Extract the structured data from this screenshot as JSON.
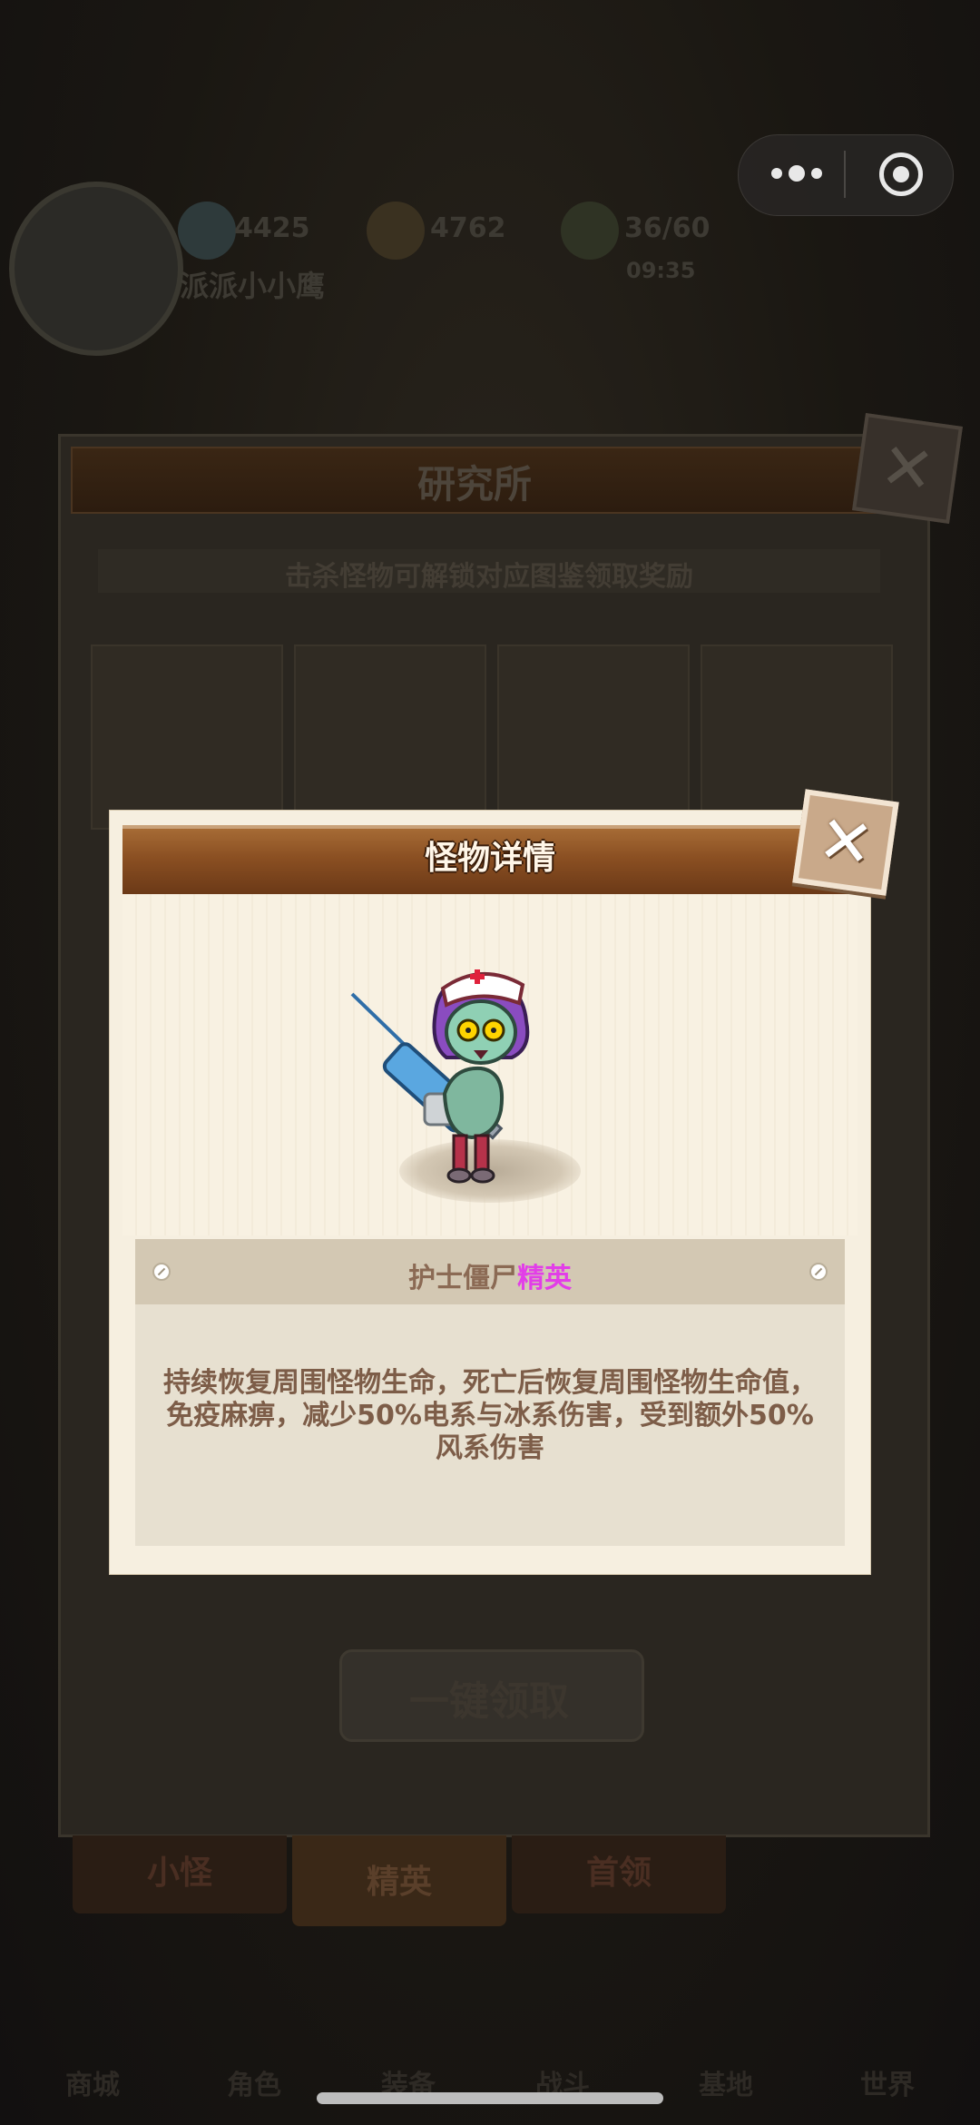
{
  "hud": {
    "gems": "4425",
    "coins": "4762",
    "energy": "36/60",
    "energy_timer": "09:35",
    "player_name": "派派小小鹰"
  },
  "lab": {
    "title": "研究所",
    "hint": "击杀怪物可解锁对应图鉴领取奖励",
    "claim_all_label": "一键领取",
    "tabs": [
      {
        "label": "小怪"
      },
      {
        "label": "精英",
        "active": true
      },
      {
        "label": "首领"
      }
    ]
  },
  "bottom_nav": [
    {
      "label": "商城"
    },
    {
      "label": "角色"
    },
    {
      "label": "装备"
    },
    {
      "label": "战斗"
    },
    {
      "label": "基地"
    },
    {
      "label": "世界"
    }
  ],
  "modal": {
    "title": "怪物详情",
    "monster_name": "护士僵尸",
    "monster_rank": "精英",
    "description": "持续恢复周围怪物生命，死亡后恢复周围怪物生命值，免疫麻痹，减少50%电系与冰系伤害，受到额外50%风系伤害"
  },
  "colors": {
    "rank_elite": "#e23ee8",
    "header_brown": "#8a4f22",
    "modal_bg": "#f6efe0"
  }
}
